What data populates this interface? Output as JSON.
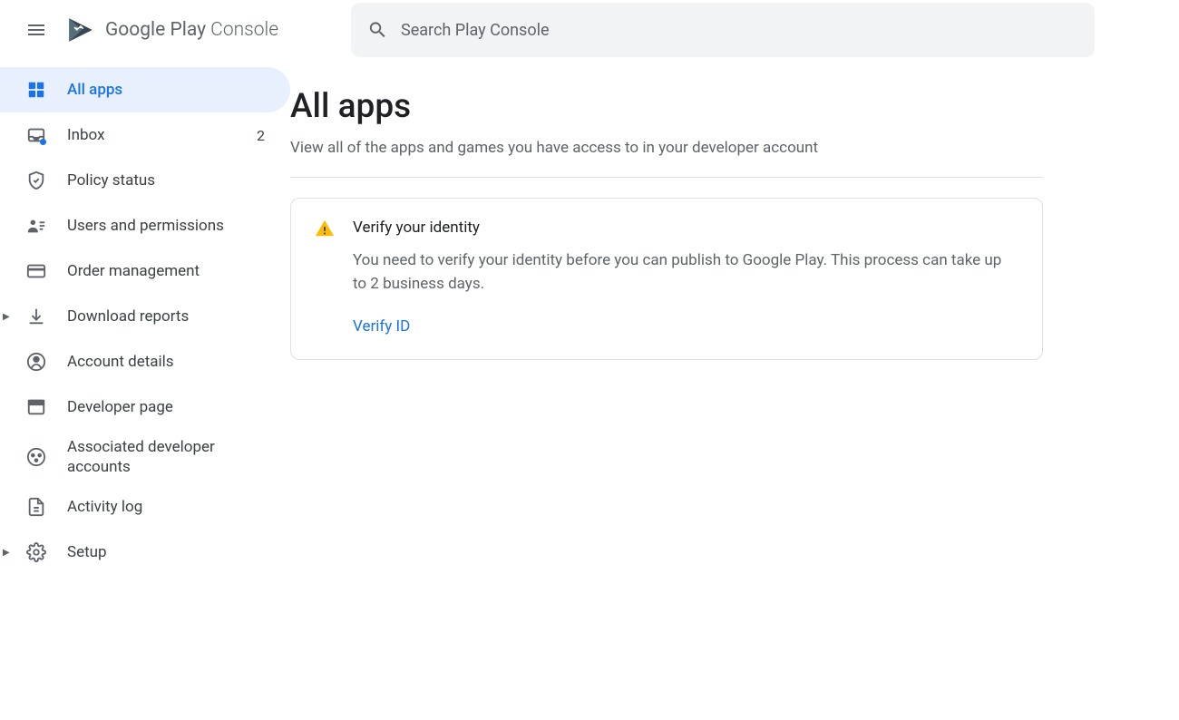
{
  "header": {
    "brand_primary": "Google Play",
    "brand_secondary": " Console",
    "search_placeholder": "Search Play Console"
  },
  "sidebar": {
    "items": [
      {
        "label": "All apps",
        "icon": "apps-icon",
        "active": true
      },
      {
        "label": "Inbox",
        "icon": "inbox-icon",
        "badge": "2",
        "dot": true
      },
      {
        "label": "Policy status",
        "icon": "shield-icon"
      },
      {
        "label": "Users and permissions",
        "icon": "users-icon"
      },
      {
        "label": "Order management",
        "icon": "card-icon"
      },
      {
        "label": "Download reports",
        "icon": "download-icon",
        "expandable": true
      },
      {
        "label": "Account details",
        "icon": "account-icon"
      },
      {
        "label": "Developer page",
        "icon": "page-icon"
      },
      {
        "label": "Associated developer accounts",
        "icon": "associated-icon",
        "multi": true
      },
      {
        "label": "Activity log",
        "icon": "log-icon"
      },
      {
        "label": "Setup",
        "icon": "setup-icon",
        "expandable": true
      }
    ]
  },
  "main": {
    "title": "All apps",
    "subtitle": "View all of the apps and games you have access to in your developer account",
    "notice": {
      "title": "Verify your identity",
      "text": "You need to verify your identity before you can publish to Google Play. This process can take up to 2 business days.",
      "action": "Verify ID"
    }
  }
}
